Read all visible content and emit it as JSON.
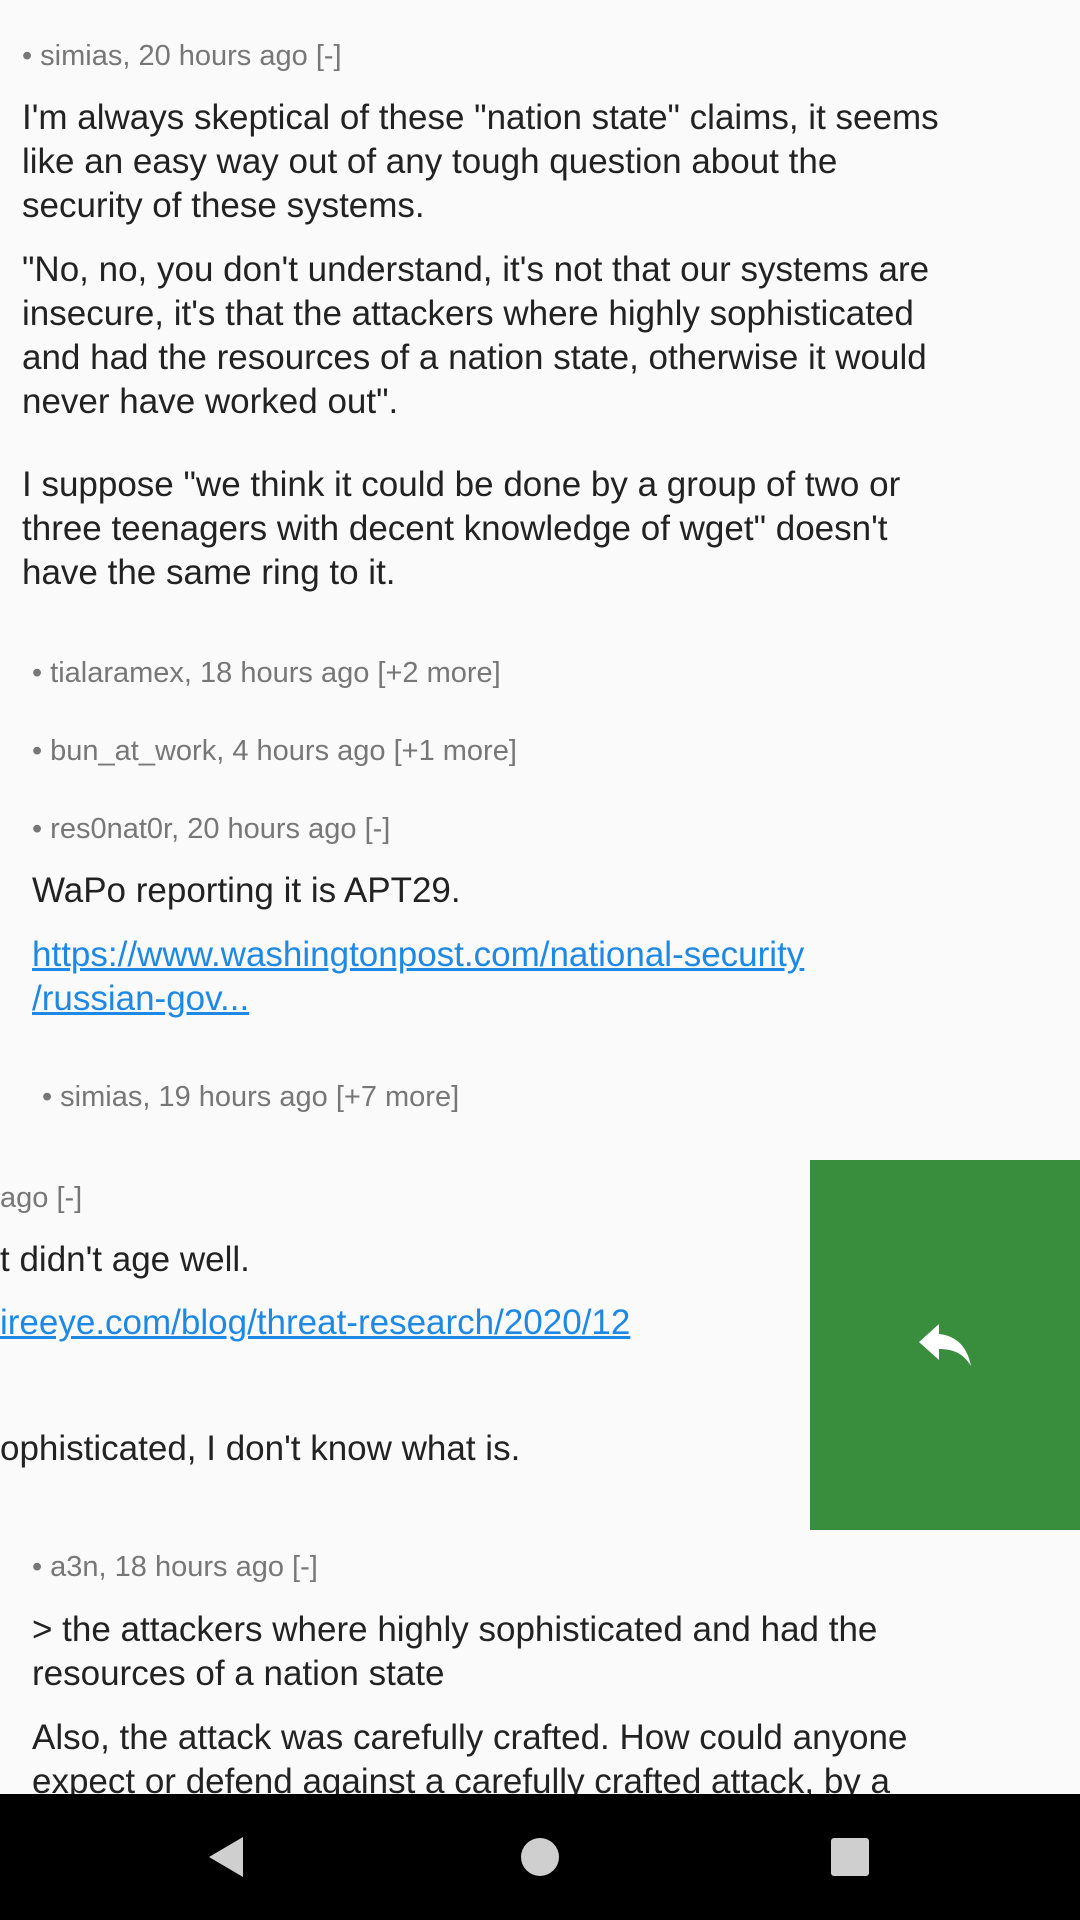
{
  "comments": {
    "c1": {
      "bullet": "•",
      "author": "simias,",
      "time": "20 hours ago",
      "toggle": "[-]",
      "p1_l1": "I'm always skeptical of these \"nation state\" claims, it seems",
      "p1_l2": "like an easy way out of any tough question about the",
      "p1_l3": "security of these systems.",
      "p2_l1": "\"No, no, you don't understand, it's not that our systems are",
      "p2_l2": "insecure, it's that the attackers where highly sophisticated",
      "p2_l3": "and had the resources of a nation state, otherwise it would",
      "p2_l4": "never have worked out\".",
      "p3_l1": "I suppose \"we think it could be done by a group of two or",
      "p3_l2": "three teenagers with decent knowledge of wget\" doesn't",
      "p3_l3": "have the same ring to it."
    },
    "c2": {
      "bullet": "•",
      "author": "tialaramex,",
      "time": "18 hours ago",
      "toggle": "[+2 more]"
    },
    "c3": {
      "bullet": "•",
      "author": "bun_at_work,",
      "time": "4 hours ago",
      "toggle": "[+1 more]"
    },
    "c4": {
      "bullet": "•",
      "author": "res0nat0r,",
      "time": "20 hours ago",
      "toggle": "[-]",
      "p1": "WaPo reporting it is APT29.",
      "link_l1": "https://www.washingtonpost.com/national-security",
      "link_l2": "/russian-gov..."
    },
    "c5": {
      "bullet": "•",
      "author": "simias,",
      "time": "19 hours ago",
      "toggle": "[+7 more]"
    },
    "c6": {
      "meta_partial": "ago [-]",
      "p1": "t didn't age well.",
      "link": "ireeye.com/blog/threat-research/2020/12",
      "p2": "ophisticated, I don't know what is."
    },
    "c7": {
      "bullet": "•",
      "author": "a3n,",
      "time": "18 hours ago",
      "toggle": "[-]",
      "p1_l1": "> the attackers where highly sophisticated and had the",
      "p1_l2": "resources of a nation state",
      "p2_l1": "Also, the attack was carefully crafted. How could anyone",
      "p2_l2": "expect or defend against a carefully crafted attack, by a"
    }
  },
  "swipe_action": {
    "icon": "reply-icon",
    "color": "#388e3c"
  },
  "navbar": {
    "back": "back-icon",
    "home": "home-icon",
    "recents": "recents-icon"
  }
}
